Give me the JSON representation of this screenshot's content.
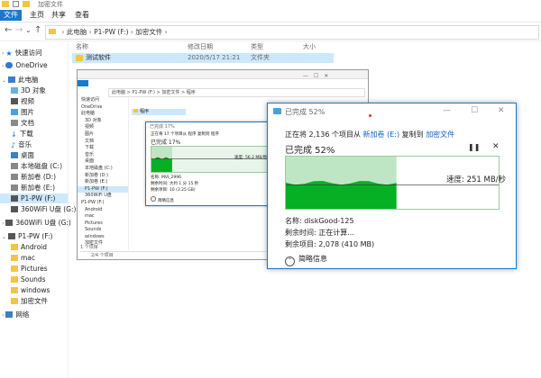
{
  "window": {
    "title": "加密文件"
  },
  "ribbon": {
    "tabs": [
      "文件",
      "主页",
      "共享",
      "查看"
    ]
  },
  "address": {
    "path": [
      "此电脑",
      "P1-PW (F:)",
      "加密文件"
    ]
  },
  "columns": [
    "名称",
    "修改日期",
    "类型",
    "大小"
  ],
  "files": [
    {
      "name": "测试软件",
      "date": "2020/5/17 21:21",
      "type": "文件夹"
    }
  ],
  "sidebar": {
    "items": [
      "快速访问",
      "OneDrive",
      "此电脑",
      "3D 对象",
      "视频",
      "图片",
      "文档",
      "下载",
      "音乐",
      "桌面",
      "本地磁盘 (C:)",
      "新加卷 (D:)",
      "新加卷 (E:)",
      "P1-PW (F:)",
      "360WiFi U盘 (G:)",
      "360WiFi U盘 (G:)",
      "P1-PW (F:)",
      "Android",
      "mac",
      "Pictures",
      "Sounds",
      "windows",
      "加密文件",
      "网络"
    ]
  },
  "dialog": {
    "title": "已完成 52%",
    "line1_prefix": "正在将 2,136 个项目从",
    "source": "新加卷 (E:)",
    "line1_mid": "复制到",
    "dest": "加密文件",
    "progress_label": "已完成 52%",
    "percent": 52,
    "speed": "速度: 251 MB/秒",
    "name": "名称: diskGood-125",
    "time_left": "剩余时间: 正在计算...",
    "items_left": "剩余项目: 2,078 (410 MB)",
    "less_info": "简略信息"
  },
  "inner": {
    "address": "此电脑 > P1-PW (F:) > 加密文件 > 程序",
    "folder": "程序",
    "status": "1 个项目",
    "status2": "2/4 个项目",
    "dialog": {
      "title": "已完成 17%",
      "line1": "正在将 17 个项目从 程序 复制到 程序",
      "progress_label": "已完成 17%",
      "percent": 17,
      "speed": "速度: 56.2 MB/秒",
      "name": "名称: MVI_2996",
      "time_left": "剩余时间: 大约 1 分 15 秒",
      "items_left": "剩余项目: 10 (3.25 GB)",
      "less_info": "简略信息"
    },
    "sidebar": [
      "快速访问",
      "OneDrive",
      "此电脑",
      "3D 对象",
      "视频",
      "图片",
      "文档",
      "下载",
      "音乐",
      "桌面",
      "本地磁盘 (C:)",
      "新加卷 (D:)",
      "新加卷 (E:)",
      "P1-PW (F:)",
      "360WiFi U盘",
      "P1-PW (F:)",
      "Android",
      "mac",
      "Pictures",
      "Sounds",
      "windows",
      "加密文件"
    ]
  },
  "colors": {
    "accent": "#1979ca",
    "progress": "#06b025",
    "progress_bg": "#bfe6c4",
    "link": "#1060c8"
  }
}
